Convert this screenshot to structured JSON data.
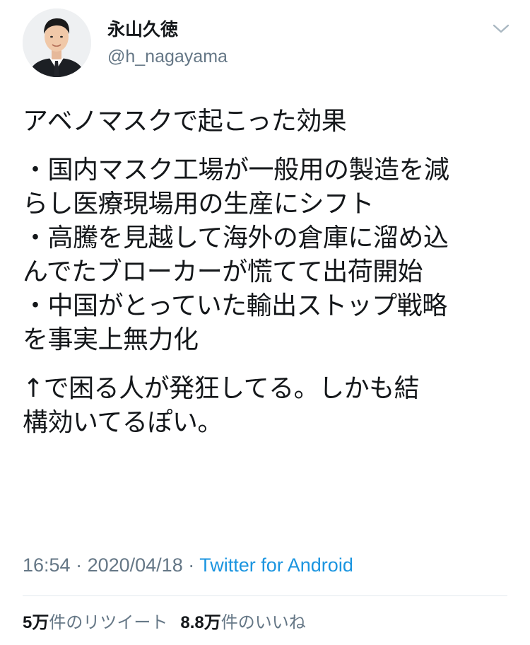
{
  "colors": {
    "text_primary": "#14171a",
    "text_secondary": "#657786",
    "link": "#1b95e0",
    "divider": "#e1e8ed"
  },
  "author": {
    "display_name": "永山久徳",
    "handle": "@h_nagayama",
    "avatar_icon": "profile-photo"
  },
  "menu_icon": "chevron-down-icon",
  "tweet": {
    "paragraph1": [
      "アベノマスクで起こった効果"
    ],
    "paragraph2": [
      "・国内マスク工場が一般用の製造を減",
      "らし医療現場用の生産にシフト",
      "・高騰を見越して海外の倉庫に溜め込",
      "んでたブローカーが慌てて出荷開始",
      "・中国がとっていた輸出ストップ戦略",
      "を事実上無力化"
    ],
    "paragraph3": [
      "↑で困る人が発狂してる。しかも結",
      "構効いてるぽい。"
    ]
  },
  "meta": {
    "time": "16:54",
    "separator": " · ",
    "date": "2020/04/18",
    "source": "Twitter for Android"
  },
  "stats": {
    "retweets_num": "5",
    "retweets_unit": "万",
    "retweets_label": "件のリツイート",
    "likes_num": "8.8",
    "likes_unit": "万",
    "likes_label": "件のいいね"
  }
}
